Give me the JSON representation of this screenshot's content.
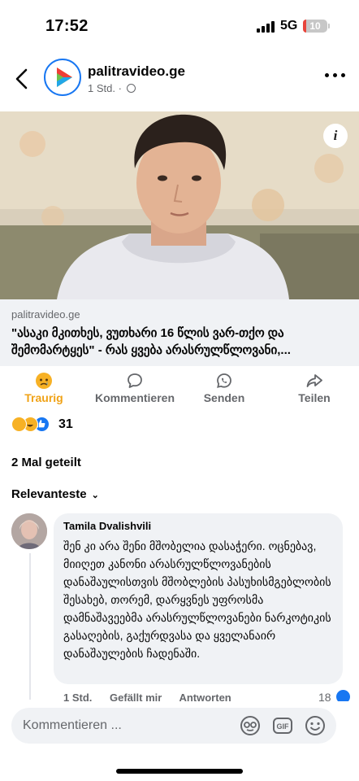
{
  "status_bar": {
    "time": "17:52",
    "network": "5G",
    "battery": "10"
  },
  "header": {
    "page_name": "palitravideo.ge",
    "meta": "1 Std. ·"
  },
  "link_preview": {
    "domain": "palitravideo.ge",
    "title": "\"ასაკი მკითხეს, ვუთხარი 16 წლის ვარ-თქო და შემომარტყეს\" - რას ყვება არასრულწლოვანი,..."
  },
  "actions": [
    {
      "label": "Traurig",
      "icon": "sad-emoji-icon"
    },
    {
      "label": "Kommentieren",
      "icon": "comment-icon"
    },
    {
      "label": "Senden",
      "icon": "whatsapp-icon"
    },
    {
      "label": "Teilen",
      "icon": "share-icon"
    }
  ],
  "reactions": {
    "count": "31",
    "types": [
      "sad",
      "haha",
      "like"
    ]
  },
  "shares": "2 Mal geteilt",
  "sort_label": "Relevanteste",
  "comment": {
    "author": "Tamila Dvalishvili",
    "text": "შენ კი არა შენი მშობელია დასაჭერი. ოცნებავ, მიიღეთ კანონი არასრულწლოვანების დანაშაულისთვის მშობლების პასუხისმგებლობის შესახებ, თორემ, დარყვნეს უფროსმა დამნაშავეებმა არასრულწლოვანები ნარკოტიკის გასაღების, გაქურდვასა და ყველანაირ დანაშაულების ჩადენაში.",
    "time": "1 Std.",
    "like_action": "Gefällt mir",
    "reply_action": "Antworten",
    "likes": "18"
  },
  "composer": {
    "placeholder": "Kommentieren ..."
  },
  "colors": {
    "accent": "#1877f2",
    "sad": "#f0a216",
    "secondary_text": "#65676b"
  }
}
